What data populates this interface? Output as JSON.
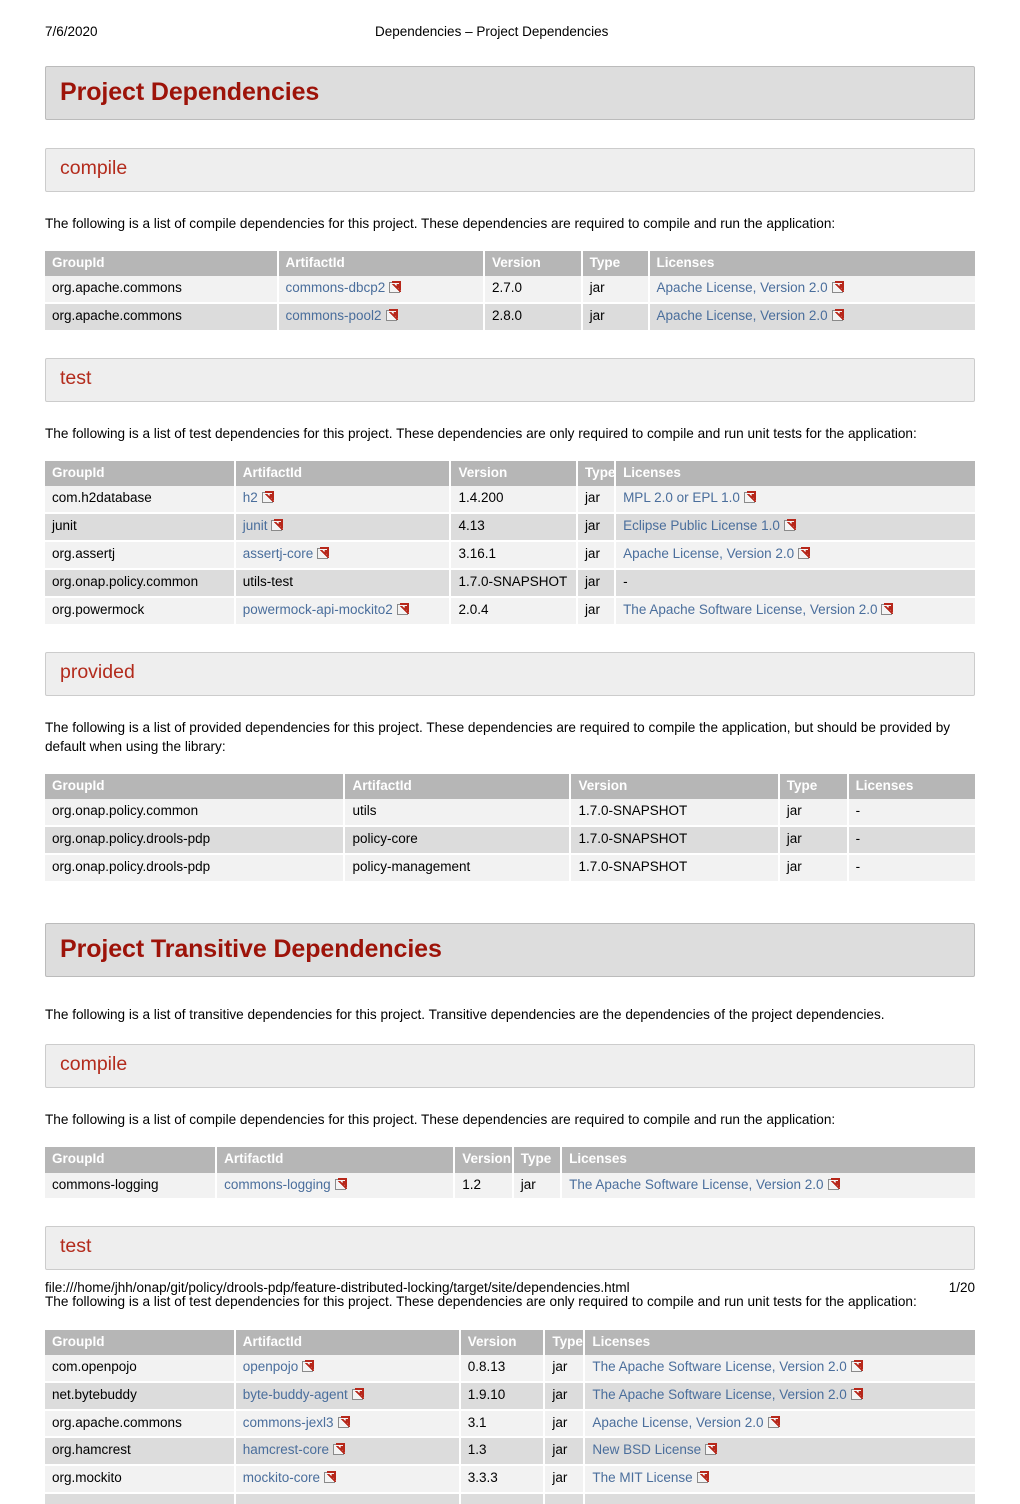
{
  "print_header": {
    "date": "7/6/2020",
    "title": "Dependencies – Project Dependencies"
  },
  "print_footer": {
    "url": "file:///home/jhh/onap/git/policy/drools-pdp/feature-distributed-locking/target/site/dependencies.html",
    "page": "1/20"
  },
  "colors": {
    "heading_red": "#9d1309",
    "subheading_red": "#b32b1c",
    "link_blue": "#4a6e9c",
    "banner_grey": "#dddddd",
    "subbanner_grey": "#eeeeee",
    "table_header_grey": "#b6b6b6",
    "row_light": "#f2f2f2",
    "row_dark": "#dcdcdc"
  },
  "icons": {
    "external_link": "external-link-icon"
  },
  "table_columns": [
    "GroupId",
    "ArtifactId",
    "Version",
    "Type",
    "Licenses"
  ],
  "sections": [
    {
      "id": "project-dependencies",
      "title": "Project Dependencies",
      "subsections": [
        {
          "id": "compile",
          "title": "compile",
          "blurb": "The following is a list of compile dependencies for this project. These dependencies are required to compile and run the application:",
          "col_widths": [
            "25.0%",
            "22.2%",
            "10.5%",
            "7.2%",
            "35.1%"
          ],
          "rows": [
            {
              "group_id": "org.apache.commons",
              "artifact_id": "commons-dbcp2",
              "artifact_link": true,
              "version": "2.7.0",
              "type": "jar",
              "license": "Apache License, Version 2.0",
              "license_link": true
            },
            {
              "group_id": "org.apache.commons",
              "artifact_id": "commons-pool2",
              "artifact_link": true,
              "version": "2.8.0",
              "type": "jar",
              "license": "Apache License, Version 2.0",
              "license_link": true
            }
          ]
        },
        {
          "id": "test",
          "title": "test",
          "blurb": "The following is a list of test dependencies for this project. These dependencies are only required to compile and run unit tests for the application:",
          "col_widths": [
            "20.4%",
            "23.2%",
            "13.6%",
            "4.1%",
            "38.7%"
          ],
          "rows": [
            {
              "group_id": "com.h2database",
              "artifact_id": "h2",
              "artifact_link": true,
              "version": "1.4.200",
              "type": "jar",
              "license": "MPL 2.0 or EPL 1.0",
              "license_link": true
            },
            {
              "group_id": "junit",
              "artifact_id": "junit",
              "artifact_link": true,
              "version": "4.13",
              "type": "jar",
              "license": "Eclipse Public License 1.0",
              "license_link": true
            },
            {
              "group_id": "org.assertj",
              "artifact_id": "assertj-core",
              "artifact_link": true,
              "version": "3.16.1",
              "type": "jar",
              "license": "Apache License, Version 2.0",
              "license_link": true
            },
            {
              "group_id": "org.onap.policy.common",
              "artifact_id": "utils-test",
              "artifact_link": false,
              "version": "1.7.0-SNAPSHOT",
              "type": "jar",
              "license": "-",
              "license_link": false
            },
            {
              "group_id": "org.powermock",
              "artifact_id": "powermock-api-mockito2",
              "artifact_link": true,
              "version": "2.0.4",
              "type": "jar",
              "license": "The Apache Software License, Version 2.0",
              "license_link": true
            }
          ]
        },
        {
          "id": "provided",
          "title": "provided",
          "blurb": "The following is a list of provided dependencies for this project. These dependencies are required to compile the application, but should be provided by default when using the library:",
          "col_widths": [
            "32.2%",
            "24.3%",
            "22.4%",
            "7.4%",
            "13.7%"
          ],
          "rows": [
            {
              "group_id": "org.onap.policy.common",
              "artifact_id": "utils",
              "artifact_link": false,
              "version": "1.7.0-SNAPSHOT",
              "type": "jar",
              "license": "-",
              "license_link": false
            },
            {
              "group_id": "org.onap.policy.drools-pdp",
              "artifact_id": "policy-core",
              "artifact_link": false,
              "version": "1.7.0-SNAPSHOT",
              "type": "jar",
              "license": "-",
              "license_link": false
            },
            {
              "group_id": "org.onap.policy.drools-pdp",
              "artifact_id": "policy-management",
              "artifact_link": false,
              "version": "1.7.0-SNAPSHOT",
              "type": "jar",
              "license": "-",
              "license_link": false
            }
          ]
        }
      ]
    },
    {
      "id": "project-transitive-dependencies",
      "title": "Project Transitive Dependencies",
      "blurb": "The following is a list of transitive dependencies for this project. Transitive dependencies are the dependencies of the project dependencies.",
      "subsections": [
        {
          "id": "transitive-compile",
          "title": "compile",
          "blurb": "The following is a list of compile dependencies for this project. These dependencies are required to compile and run the application:",
          "col_widths": [
            "18.4%",
            "25.6%",
            "6.3%",
            "5.2%",
            "44.5%"
          ],
          "rows": [
            {
              "group_id": "commons-logging",
              "artifact_id": "commons-logging",
              "artifact_link": true,
              "version": "1.2",
              "type": "jar",
              "license": "The Apache Software License, Version 2.0",
              "license_link": true
            }
          ]
        },
        {
          "id": "transitive-test",
          "title": "test",
          "blurb": "The following is a list of test dependencies for this project. These dependencies are only required to compile and run unit tests for the application:",
          "col_widths": [
            "20.4%",
            "24.2%",
            "9.1%",
            "4.3%",
            "42.0%"
          ],
          "rows": [
            {
              "group_id": "com.openpojo",
              "artifact_id": "openpojo",
              "artifact_link": true,
              "version": "0.8.13",
              "type": "jar",
              "license": "The Apache Software License, Version 2.0",
              "license_link": true
            },
            {
              "group_id": "net.bytebuddy",
              "artifact_id": "byte-buddy-agent",
              "artifact_link": true,
              "version": "1.9.10",
              "type": "jar",
              "license": "The Apache Software License, Version 2.0",
              "license_link": true
            },
            {
              "group_id": "org.apache.commons",
              "artifact_id": "commons-jexl3",
              "artifact_link": true,
              "version": "3.1",
              "type": "jar",
              "license": "Apache License, Version 2.0",
              "license_link": true
            },
            {
              "group_id": "org.hamcrest",
              "artifact_id": "hamcrest-core",
              "artifact_link": true,
              "version": "1.3",
              "type": "jar",
              "license": "New BSD License",
              "license_link": true
            },
            {
              "group_id": "org.mockito",
              "artifact_id": "mockito-core",
              "artifact_link": true,
              "version": "3.3.3",
              "type": "jar",
              "license": "The MIT License",
              "license_link": true
            }
          ]
        }
      ]
    }
  ]
}
